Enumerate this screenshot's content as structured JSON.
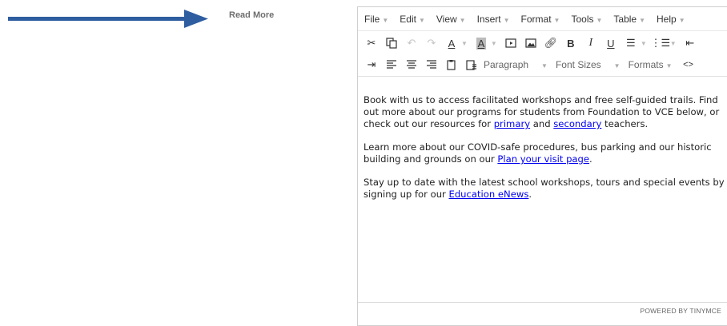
{
  "header": {
    "read_more": "Read More"
  },
  "menubar": [
    {
      "label": "File"
    },
    {
      "label": "Edit"
    },
    {
      "label": "View"
    },
    {
      "label": "Insert"
    },
    {
      "label": "Format"
    },
    {
      "label": "Tools"
    },
    {
      "label": "Table"
    },
    {
      "label": "Help"
    }
  ],
  "toolbar": {
    "paragraph": "Paragraph",
    "font_sizes": "Font Sizes",
    "formats": "Formats"
  },
  "content": {
    "p1": {
      "before": "Book with us to access facilitated workshops and free self-guided trails. Find out more about our programs for students from Foundation to VCE below, or check out our resources for ",
      "link1": "primary",
      "mid": " and ",
      "link2": "secondary",
      "after": " teachers."
    },
    "p2": {
      "before": "Learn more about our COVID-safe procedures, bus parking and our historic building and grounds on our ",
      "link": "Plan your visit page",
      "after": "."
    },
    "p3": {
      "before": "Stay up to date with the latest school workshops, tours and special events by signing up for our ",
      "link": "Education eNews",
      "after": "."
    }
  },
  "statusbar": {
    "powered": "POWERED BY TINYMCE"
  },
  "colors": {
    "arrow": "#2e5da0",
    "link": "#0000ee"
  }
}
